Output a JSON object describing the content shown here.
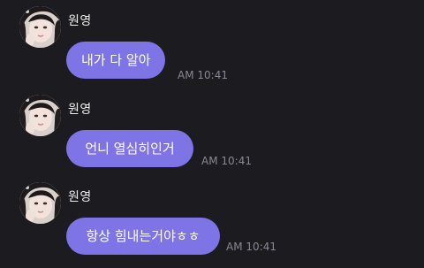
{
  "messages": [
    {
      "sender": "원영",
      "text": "내가 다 알아",
      "time": "AM 10:41",
      "avatar_icon": "profile-photo"
    },
    {
      "sender": "원영",
      "text": "언니 열심히인거",
      "time": "AM 10:41",
      "avatar_icon": "profile-photo"
    },
    {
      "sender": "원영",
      "text": "항상 힘내는거야ㅎㅎ",
      "time": "AM 10:41",
      "avatar_icon": "profile-photo"
    }
  ],
  "colors": {
    "background": "#1c1c20",
    "bubble": "#7e74e6",
    "bubble_text": "#ffffff",
    "sender_text": "#eeeeee",
    "time_text": "#888894"
  }
}
